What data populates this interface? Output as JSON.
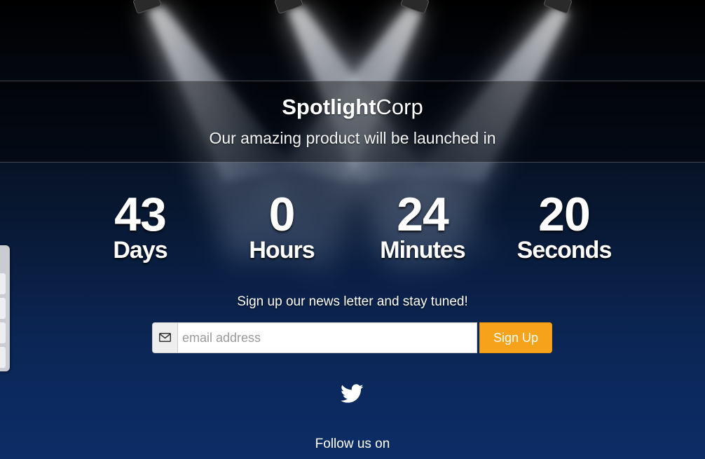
{
  "brand": {
    "bold": "Spotlight",
    "regular": "Corp"
  },
  "tagline": "Our amazing product will be launched in",
  "countdown": [
    {
      "value": "43",
      "label": "Days"
    },
    {
      "value": "0",
      "label": "Hours"
    },
    {
      "value": "24",
      "label": "Minutes"
    },
    {
      "value": "20",
      "label": "Seconds"
    }
  ],
  "newsletter": {
    "text": "Sign up our news letter and stay tuned!",
    "email_placeholder": "email address",
    "email_value": "",
    "button_label": "Sign Up",
    "icon": "envelope-icon"
  },
  "social": {
    "icon": "twitter-icon"
  },
  "follow_text": "Follow us on",
  "colors": {
    "accent": "#f7a21b",
    "background_top": "#000000",
    "background_bottom": "#0d2d67"
  }
}
